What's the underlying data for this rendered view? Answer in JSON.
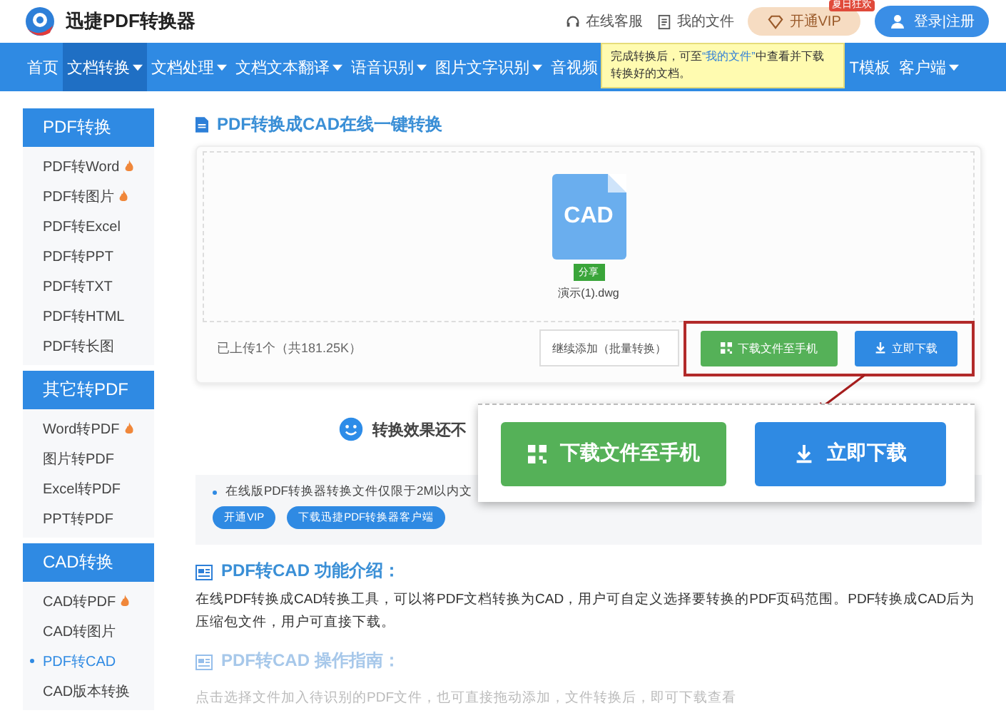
{
  "header": {
    "logo_text": "迅捷PDF转换器",
    "links": [
      {
        "kind": "service",
        "label": "在线客服"
      },
      {
        "kind": "files",
        "label": "我的文件"
      }
    ],
    "vip_button": "开通VIP",
    "vip_badge": "夏日狂欢",
    "login_button": "登录|注册"
  },
  "nav": {
    "left_items": [
      {
        "label": "首页",
        "menu": false,
        "selected": false
      },
      {
        "label": "文档转换",
        "menu": true,
        "selected": true
      },
      {
        "label": "文档处理",
        "menu": true,
        "selected": false
      },
      {
        "label": "文档文本翻译",
        "menu": true,
        "selected": false
      },
      {
        "label": "语音识别",
        "menu": true,
        "selected": false
      },
      {
        "label": "图片文字识别",
        "menu": true,
        "selected": false
      },
      {
        "label": "音视频",
        "menu": false,
        "selected": false
      }
    ],
    "right_items": [
      {
        "label": "T模板",
        "menu": false,
        "selected": false
      },
      {
        "label": "客户端",
        "menu": true,
        "selected": false
      }
    ]
  },
  "tooltip": {
    "before": "完成转换后，可至",
    "link": "“我的文件”",
    "after": "中查看并下载转换好的文档。"
  },
  "sidebar": {
    "groups": [
      {
        "title": "PDF转换",
        "items": [
          {
            "label": "PDF转Word",
            "hot": true,
            "selected": false
          },
          {
            "label": "PDF转图片",
            "hot": true,
            "selected": false
          },
          {
            "label": "PDF转Excel",
            "hot": false,
            "selected": false
          },
          {
            "label": "PDF转PPT",
            "hot": false,
            "selected": false
          },
          {
            "label": "PDF转TXT",
            "hot": false,
            "selected": false
          },
          {
            "label": "PDF转HTML",
            "hot": false,
            "selected": false
          },
          {
            "label": "PDF转长图",
            "hot": false,
            "selected": false
          }
        ]
      },
      {
        "title": "其它转PDF",
        "items": [
          {
            "label": "Word转PDF",
            "hot": true,
            "selected": false
          },
          {
            "label": "图片转PDF",
            "hot": false,
            "selected": false
          },
          {
            "label": "Excel转PDF",
            "hot": false,
            "selected": false
          },
          {
            "label": "PPT转PDF",
            "hot": false,
            "selected": false
          }
        ]
      },
      {
        "title": "CAD转换",
        "items": [
          {
            "label": "CAD转PDF",
            "hot": true,
            "selected": false
          },
          {
            "label": "CAD转图片",
            "hot": false,
            "selected": false
          },
          {
            "label": "PDF转CAD",
            "hot": false,
            "selected": true
          },
          {
            "label": "CAD版本转换",
            "hot": false,
            "selected": false
          }
        ]
      }
    ]
  },
  "page_title": "PDF转换成CAD在线一键转换",
  "upload": {
    "file_type": "CAD",
    "share_tag": "分享",
    "file_name": "演示(1).dwg",
    "summary": "已上传1个（共181.25K）",
    "add_button": "继续添加（批量转换）",
    "phone_button": "下载文件至手机",
    "download_button": "立即下载"
  },
  "callout": {
    "phone_button": "下载文件至手机",
    "download_button": "立即下载"
  },
  "feedback": "转换效果还不",
  "notice": {
    "text": "在线版PDF转换器转换文件仅限于2M以内文",
    "buttons": [
      "开通VIP",
      "下载迅捷PDF转换器客户端"
    ]
  },
  "sections": [
    {
      "title": "PDF转CAD 功能介绍：",
      "text": "在线PDF转换成CAD转换工具，可以将PDF文档转换为CAD，用户可自定义选择要转换的PDF页码范围。PDF转换成CAD后为压缩包文件，用户可直接下载。"
    },
    {
      "title": "PDF转CAD 操作指南：",
      "text": "点击选择文件加入待识别的PDF文件，也可直接拖动添加，文件转换后，即可下载查看"
    }
  ]
}
